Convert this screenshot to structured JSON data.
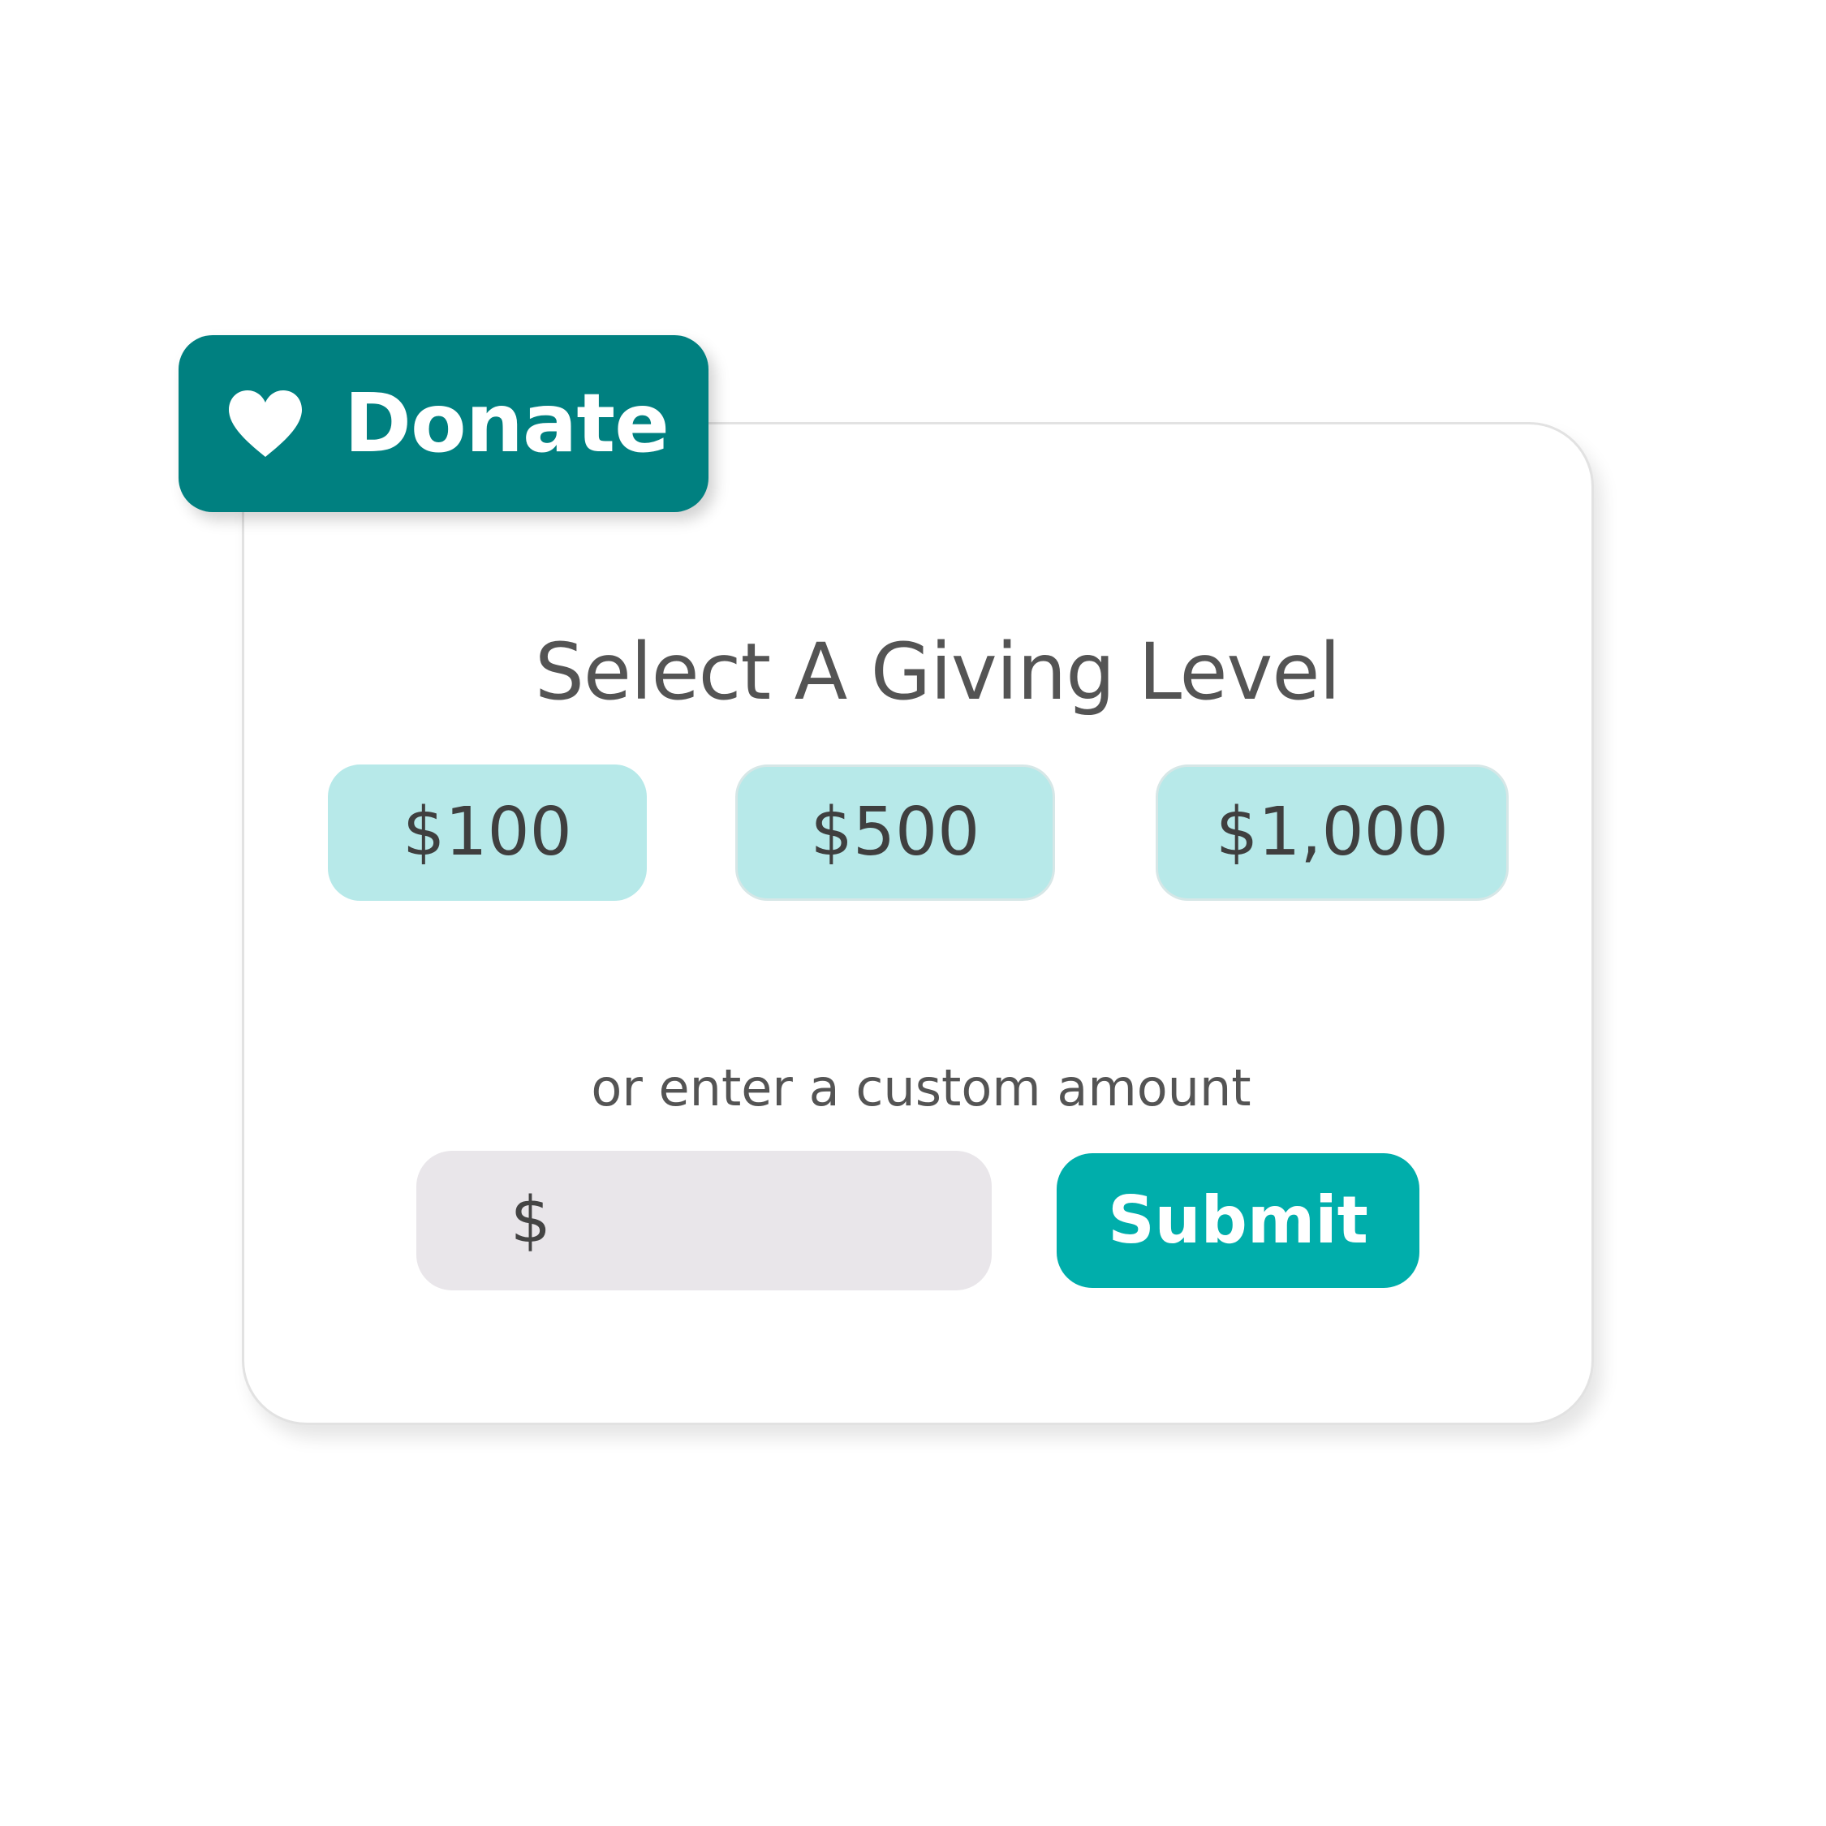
{
  "donate_tab": {
    "label": "Donate",
    "icon": "heart-icon",
    "color": "#008080"
  },
  "heading": "Select A Giving Level",
  "giving_levels": [
    {
      "label": "$100"
    },
    {
      "label": "$500"
    },
    {
      "label": "$1,000"
    }
  ],
  "custom_amount": {
    "label": "or enter a custom amount",
    "currency_symbol": "$",
    "value": ""
  },
  "submit": {
    "label": "Submit",
    "color": "#00aeab"
  },
  "colors": {
    "level_bg": "#b7e9e9",
    "field_bg": "#e9e6ea",
    "text": "#545454"
  }
}
